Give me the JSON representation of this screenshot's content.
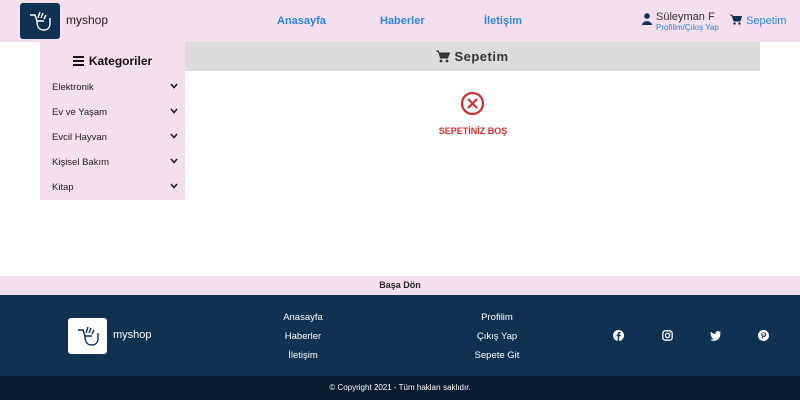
{
  "header": {
    "brand": "myshop",
    "nav": [
      "Anasayfa",
      "Haberler",
      "İletişim"
    ],
    "user_name": "Süleyman F",
    "user_links": "Profilim/Çıkış Yap",
    "cart_label": "Sepetim"
  },
  "sidebar": {
    "title": "Kategoriler",
    "items": [
      {
        "label": "Elektronik"
      },
      {
        "label": "Ev ve Yaşam"
      },
      {
        "label": "Evcil Hayvan"
      },
      {
        "label": "Kişisel Bakım"
      },
      {
        "label": "Kitap"
      }
    ]
  },
  "main": {
    "title": "Sepetim",
    "empty_message": "SEPETİNİZ BOŞ"
  },
  "back_to_top": "Başa Dön",
  "footer": {
    "brand": "myshop",
    "col1": [
      "Anasayfa",
      "Haberler",
      "İletişim"
    ],
    "col2": [
      "Profilim",
      "Çıkış Yap",
      "Sepete Git"
    ],
    "social": [
      "facebook-icon",
      "instagram-icon",
      "twitter-icon",
      "pinterest-icon"
    ],
    "copyright": "© Copyright 2021 - Tüm hakları saklıdır."
  },
  "colors": {
    "accent": "#2e86de",
    "header_bg": "#f4dfee",
    "footer_bg": "#0f3152",
    "copyright_bg": "#071b2e",
    "error": "#d32f2f"
  }
}
